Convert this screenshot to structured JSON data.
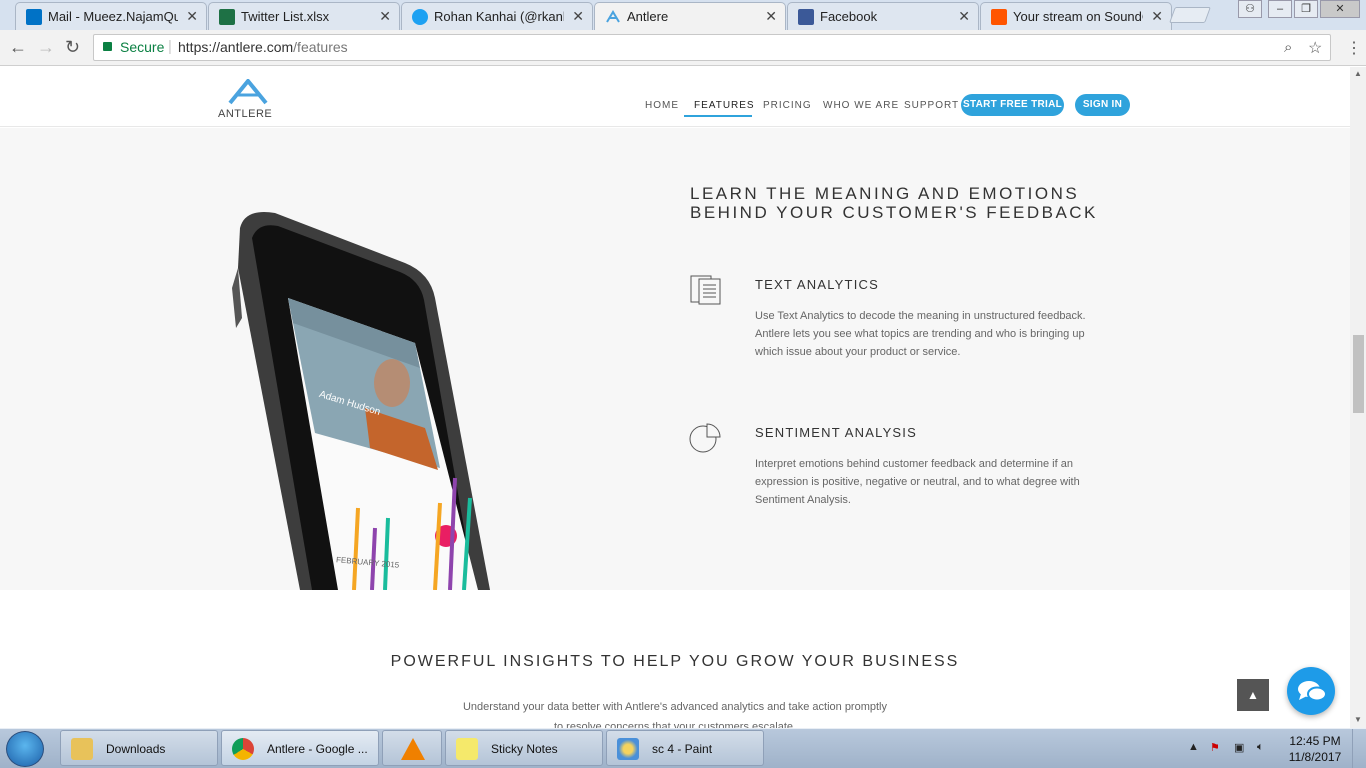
{
  "browser": {
    "tabs": [
      {
        "label": "Mail - Mueez.NajamQure",
        "icon": "outlook-icon",
        "color": "#0072c6"
      },
      {
        "label": "Twitter List.xlsx",
        "icon": "excel-icon",
        "color": "#1e7145"
      },
      {
        "label": "Rohan Kanhai (@rkanhai",
        "icon": "twitter-icon",
        "color": "#1da1f2"
      },
      {
        "label": "Antlere",
        "icon": "antlere-icon",
        "color": "#4aa3df"
      },
      {
        "label": "Facebook",
        "icon": "facebook-icon",
        "color": "#3b5998"
      },
      {
        "label": "Your stream on SoundCl",
        "icon": "soundcloud-icon",
        "color": "#ff5500"
      }
    ],
    "tab_close": "✕",
    "secure_label": "Secure",
    "url_prefix": "https://antlere.com",
    "url_path": "/features"
  },
  "site": {
    "logo_text": "ANTLERE",
    "brand_color": "#2fa3dc",
    "nav": [
      "HOME",
      "FEATURES",
      "PRICING",
      "WHO WE ARE",
      "SUPPORT"
    ],
    "trial_button": "START FREE TRIAL",
    "signin_button": "SIGN IN",
    "hero_title_line1": "LEARN THE MEANING AND EMOTIONS",
    "hero_title_line2": "BEHIND YOUR CUSTOMER'S FEEDBACK",
    "features": [
      {
        "icon": "document-icon",
        "title": "TEXT ANALYTICS",
        "lines": [
          "Use Text Analytics to decode the meaning in unstructured feedback.",
          "Antlere lets you see what topics are trending and who is bringing up",
          "which issue about your product or service."
        ]
      },
      {
        "icon": "pie-chart-icon",
        "title": "SENTIMENT ANALYSIS",
        "lines": [
          "Interpret emotions behind customer feedback and determine if an",
          "expression is positive, negative or neutral, and to what degree with",
          "Sentiment Analysis."
        ]
      }
    ],
    "phone_name": "Adam Hudson",
    "phone_month": "FEBRUARY 2015",
    "section2_title": "POWERFUL INSIGHTS TO HELP YOU GROW YOUR BUSINESS",
    "section2_line1": "Understand your data better with Antlere's advanced analytics and take action promptly",
    "section2_line2": "to resolve concerns that your customers escalate."
  },
  "taskbar": {
    "items": [
      {
        "label": "Downloads",
        "icon": "folder-icon"
      },
      {
        "label": "Antlere - Google ...",
        "icon": "chrome-icon"
      },
      {
        "label": "",
        "icon": "vlc-icon"
      },
      {
        "label": "Sticky Notes",
        "icon": "sticky-notes-icon"
      },
      {
        "label": "sc 4 - Paint",
        "icon": "paint-icon"
      }
    ],
    "time": "12:45 PM",
    "date": "11/8/2017"
  }
}
